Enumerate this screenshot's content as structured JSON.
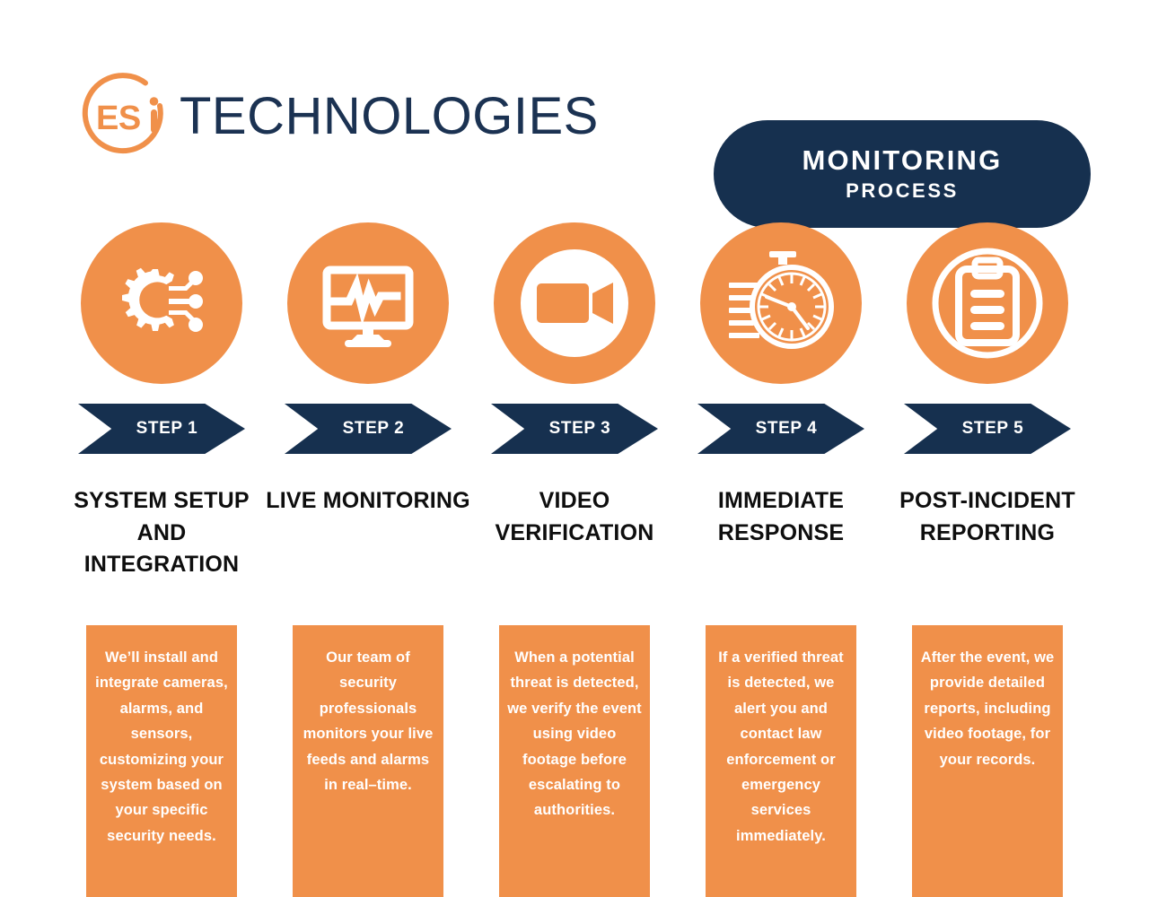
{
  "brand": {
    "logo_icon": "esi-circle-logo",
    "logo_letters": "ESi",
    "wordmark": "TECHNOLOGIES"
  },
  "title_badge": {
    "line1": "MONITORING",
    "line2": "PROCESS"
  },
  "colors": {
    "orange": "#F0904A",
    "navy": "#16304F",
    "white": "#FFFFFF",
    "text_dark": "#0E0E0E"
  },
  "steps": [
    {
      "icon": "gear-circuit-icon",
      "step_label": "STEP 1",
      "title": "SYSTEM SETUP AND INTEGRATION",
      "description": "We’ll install and integrate cameras, alarms, and sensors, customizing your system based on your specific security needs."
    },
    {
      "icon": "monitor-waveform-icon",
      "step_label": "STEP 2",
      "title": "LIVE MONITORING",
      "description": "Our team of security professionals monitors your live feeds and alarms in real–time."
    },
    {
      "icon": "video-camera-circle-icon",
      "step_label": "STEP 3",
      "title": "VIDEO VERIFICATION",
      "description": "When a potential threat is detected, we verify the event using video footage before escalating to authorities."
    },
    {
      "icon": "stopwatch-speed-icon",
      "step_label": "STEP 4",
      "title": "IMMEDIATE RESPONSE",
      "description": "If a verified threat is detected, we alert you and contact law enforcement or emergency services immediately."
    },
    {
      "icon": "clipboard-report-icon",
      "step_label": "STEP 5",
      "title": "POST-INCIDENT REPORTING",
      "description": "After the event, we provide detailed reports, including video footage, for your records."
    }
  ]
}
